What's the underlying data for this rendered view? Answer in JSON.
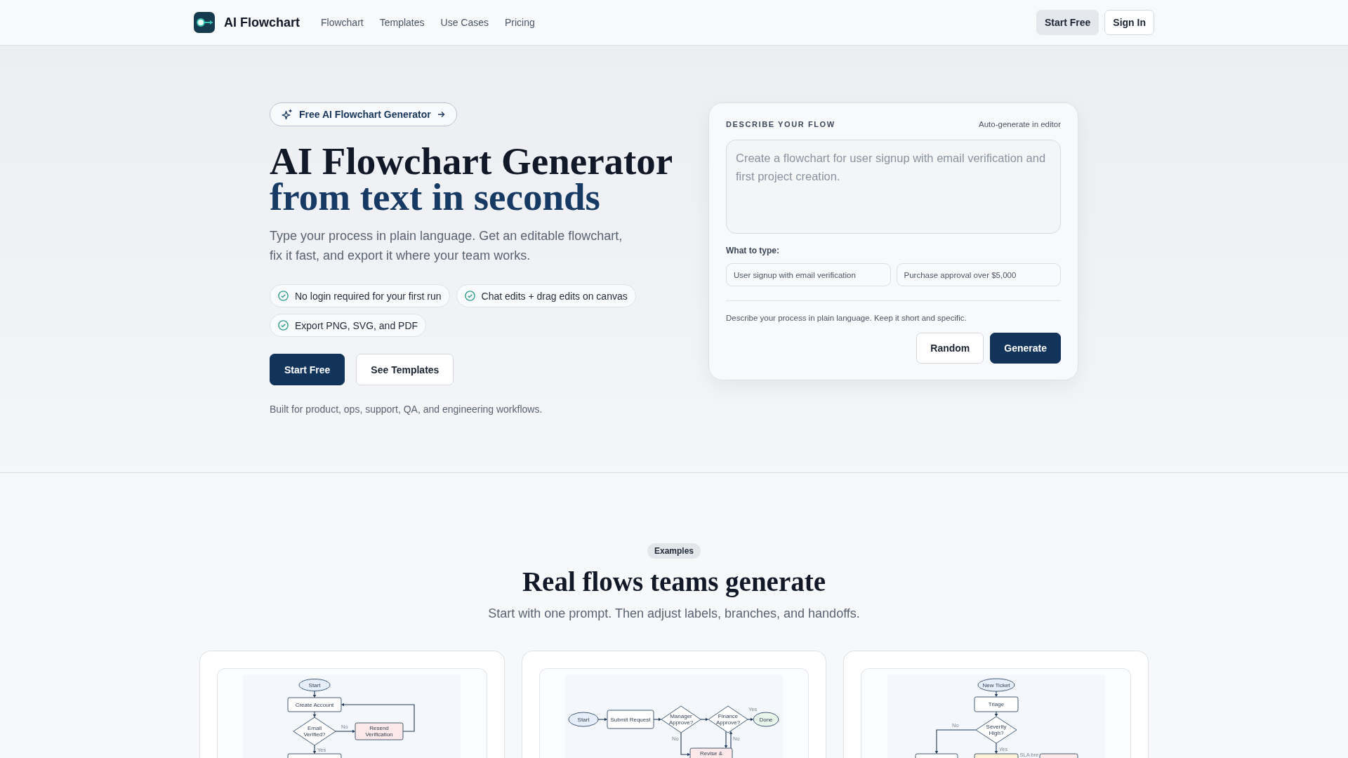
{
  "header": {
    "brand": "AI Flowchart",
    "nav": [
      "Flowchart",
      "Templates",
      "Use Cases",
      "Pricing"
    ],
    "actions": [
      {
        "label": "Start Free",
        "kind": "secondary"
      },
      {
        "label": "Sign In",
        "kind": "outline"
      }
    ]
  },
  "hero": {
    "badge": "Free AI Flowchart Generator",
    "title": "AI Flowchart Generator",
    "title_accent": "from text in seconds",
    "subtitle": "Type your process in plain language. Get an editable flowchart, fix it fast, and export it where your team works.",
    "features": [
      "No login required for your first run",
      "Chat edits + drag edits on canvas",
      "Export PNG, SVG, and PDF"
    ],
    "buttons": [
      {
        "label": "Start Free",
        "kind": "primary"
      },
      {
        "label": "See Templates",
        "kind": "outline"
      }
    ],
    "note": "Built for product, ops, support, QA, and engineering workflows."
  },
  "prompt_card": {
    "label": "DESCRIBE YOUR FLOW",
    "mode": "Auto-generate in editor",
    "placeholder": "Create a flowchart for user signup with email verification and first project creation.",
    "examples_label": "What to type:",
    "examples": [
      "User signup with email verification",
      "Purchase approval over $5,000"
    ],
    "hint": "Describe your process in plain language. Keep it short and specific.",
    "buttons": [
      {
        "label": "Random",
        "kind": "outline"
      },
      {
        "label": "Generate",
        "kind": "primary"
      }
    ]
  },
  "examples": {
    "tag": "Examples",
    "title": "Real flows teams generate",
    "subtitle": "Start with one prompt. Then adjust labels, branches, and handoffs.",
    "cards": [
      {
        "nodes": [
          {
            "kind": "terminal",
            "text": "Start",
            "color": "#e6eefb"
          },
          {
            "kind": "process",
            "text": "Create Account",
            "color": "#ffffff"
          },
          {
            "kind": "decision",
            "text": "Email Verified?",
            "color": "#ffffff"
          },
          {
            "kind": "process",
            "text": "Resend Verification",
            "color": "#fde9e9"
          },
          {
            "kind": "process",
            "color": "#ffffff"
          }
        ],
        "edge_labels": [
          "No",
          "Yes"
        ]
      },
      {
        "nodes": [
          {
            "kind": "terminal",
            "text": "Start",
            "color": "#e6eefb"
          },
          {
            "kind": "process",
            "text": "Submit Request",
            "color": "#ffffff"
          },
          {
            "kind": "decision",
            "text": "Manager Approve?",
            "color": "#ffffff"
          },
          {
            "kind": "decision",
            "text": "Finance Approve?",
            "color": "#ffffff"
          },
          {
            "kind": "terminal",
            "text": "Done",
            "color": "#e7f5eb"
          },
          {
            "kind": "process",
            "text": "Revise &",
            "color": "#fde9e9"
          }
        ],
        "edge_labels": [
          "Yes",
          "No",
          "No"
        ]
      },
      {
        "nodes": [
          {
            "kind": "terminal",
            "text": "New Ticket",
            "color": "#e6eefb"
          },
          {
            "kind": "process",
            "text": "Triage",
            "color": "#ffffff"
          },
          {
            "kind": "decision",
            "text": "Severity High?",
            "color": "#ffffff"
          },
          {
            "kind": "process",
            "color": "#ffffff"
          },
          {
            "kind": "process",
            "color": "#fdf2d5"
          },
          {
            "kind": "process",
            "color": "#fde9e9"
          }
        ],
        "edge_labels": [
          "No",
          "Yes",
          "SLA bre"
        ]
      }
    ]
  }
}
